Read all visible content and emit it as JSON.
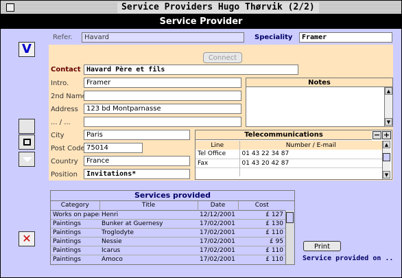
{
  "window": {
    "title": "Service Providers Hugo Thørvik (2/2)"
  },
  "header": {
    "title": "Service Provider"
  },
  "form": {
    "refer_label": "Refer.",
    "refer_value": "Havard",
    "speciality_label": "Speciality",
    "speciality_value": "Framer",
    "connect_label": "Connect",
    "contact_label": "Contact",
    "contact_value": "Havard Père et fils",
    "intro_label": "Intro.",
    "intro_value": "Framer",
    "second_name_label": "2nd Name",
    "second_name_value": "",
    "address_label": "Address",
    "address_value": "123 bd Montparnasse",
    "address2_label": "... / ...",
    "address2_value": "",
    "city_label": "City",
    "city_value": "Paris",
    "postcode_label": "Post Code",
    "postcode_value": "75014",
    "country_label": "Country",
    "country_value": "France",
    "position_label": "Position",
    "position_value": "Invitations*"
  },
  "notes": {
    "title": "Notes"
  },
  "telecom": {
    "title": "Telecommunications",
    "col_line": "Line",
    "col_number": "Number / E-mail",
    "rows": [
      {
        "line": "Tel Office",
        "number": "01 43 22 34 87"
      },
      {
        "line": "Fax",
        "number": "01 43 20 42 87"
      }
    ]
  },
  "services": {
    "title": "Services provided",
    "columns": [
      "Category",
      "Title",
      "Date",
      "Cost"
    ],
    "rows": [
      {
        "category": "Works on paper",
        "title": "Henri",
        "date": "12/12/2001",
        "cost": "£ 127"
      },
      {
        "category": "Paintings",
        "title": "Bunker at Guernesy",
        "date": "17/02/2001",
        "cost": "£ 130"
      },
      {
        "category": "Paintings",
        "title": "Troglodyte",
        "date": "17/02/2001",
        "cost": "£ 110"
      },
      {
        "category": "Paintings",
        "title": "Nessie",
        "date": "17/02/2001",
        "cost": "£ 95"
      },
      {
        "category": "Paintings",
        "title": "Icarus",
        "date": "17/02/2001",
        "cost": "£ 110"
      },
      {
        "category": "Paintings",
        "title": "Amoco",
        "date": "17/02/2001",
        "cost": "£ 110"
      }
    ],
    "print_label": "Print",
    "footer_label": "Service provided on .."
  },
  "sidebar": {
    "validate_glyph": "V",
    "delete_glyph": "✕"
  },
  "colors": {
    "panel": "#ccccff",
    "form_bg": "#ffe4bc",
    "accent": "#0000cc",
    "delete": "#cc0000"
  }
}
